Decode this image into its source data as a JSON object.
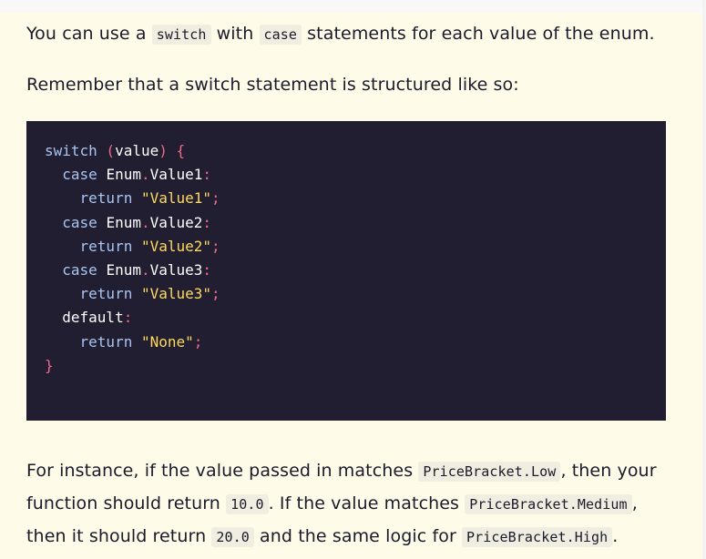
{
  "intro": {
    "t1": "You can use a ",
    "code1": "switch",
    "t2": " with ",
    "code2": "case",
    "t3": " statements for each value of the enum."
  },
  "remember": "Remember that a switch statement is structured like so:",
  "code": {
    "l1_kw": "switch",
    "l1_open": " (",
    "l1_id": "value",
    "l1_close": ") {",
    "case_kw": "case",
    "enum": "Enum",
    "dot": ".",
    "v1": "Value1",
    "v2": "Value2",
    "v3": "Value3",
    "colon": ":",
    "return_kw": "return",
    "s1": "\"Value1\"",
    "s2": "\"Value2\"",
    "s3": "\"Value3\"",
    "semi": ";",
    "default_kw": "default",
    "s_none": "\"None\"",
    "close_brace": "}"
  },
  "instance": {
    "t1": "For instance, if the value passed in matches ",
    "c1": "PriceBracket.Low",
    "t2": ", then your function should return ",
    "c2": "10.0",
    "t3": ". If the value matches ",
    "c3": "PriceBracket.Medium",
    "t4": ", then it should return ",
    "c4": "20.0",
    "t5": " and the same logic for ",
    "c5": "PriceBracket.High",
    "t6": "."
  },
  "colors": {
    "page_bg": "#fefbe9",
    "code_bg": "#201e30",
    "keyword": "#a9c5f2",
    "punctuation": "#f0698a",
    "string": "#ffd95e"
  }
}
